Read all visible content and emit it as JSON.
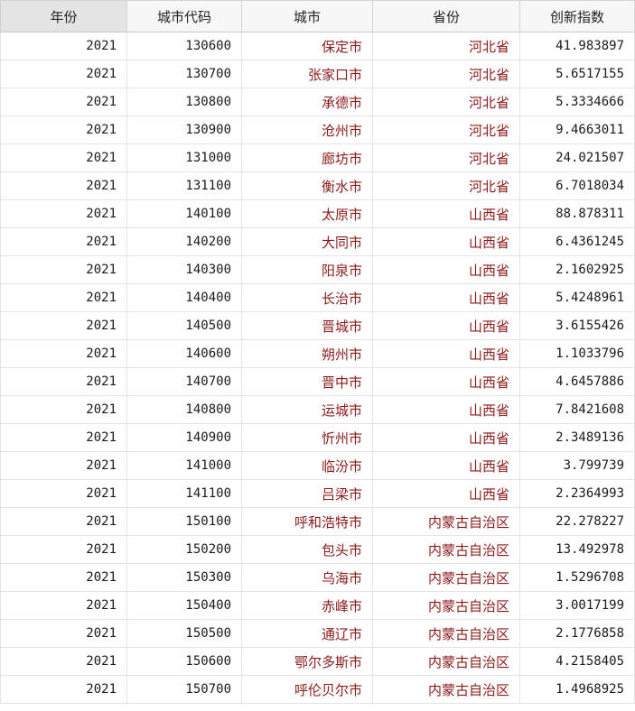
{
  "colors": {
    "string_text": "#8b1a1a",
    "numeric_text": "#1a1a1a",
    "header_bg": "#f7f7f7",
    "selected_header_bg": "#e4e4e4",
    "grid_line": "#e3e3e3"
  },
  "table": {
    "columns": [
      "年份",
      "城市代码",
      "城市",
      "省份",
      "创新指数"
    ],
    "rows": [
      [
        "2021",
        "130600",
        "保定市",
        "河北省",
        "41.983897"
      ],
      [
        "2021",
        "130700",
        "张家口市",
        "河北省",
        "5.6517155"
      ],
      [
        "2021",
        "130800",
        "承德市",
        "河北省",
        "5.3334666"
      ],
      [
        "2021",
        "130900",
        "沧州市",
        "河北省",
        "9.4663011"
      ],
      [
        "2021",
        "131000",
        "廊坊市",
        "河北省",
        "24.021507"
      ],
      [
        "2021",
        "131100",
        "衡水市",
        "河北省",
        "6.7018034"
      ],
      [
        "2021",
        "140100",
        "太原市",
        "山西省",
        "88.878311"
      ],
      [
        "2021",
        "140200",
        "大同市",
        "山西省",
        "6.4361245"
      ],
      [
        "2021",
        "140300",
        "阳泉市",
        "山西省",
        "2.1602925"
      ],
      [
        "2021",
        "140400",
        "长治市",
        "山西省",
        "5.4248961"
      ],
      [
        "2021",
        "140500",
        "晋城市",
        "山西省",
        "3.6155426"
      ],
      [
        "2021",
        "140600",
        "朔州市",
        "山西省",
        "1.1033796"
      ],
      [
        "2021",
        "140700",
        "晋中市",
        "山西省",
        "4.6457886"
      ],
      [
        "2021",
        "140800",
        "运城市",
        "山西省",
        "7.8421608"
      ],
      [
        "2021",
        "140900",
        "忻州市",
        "山西省",
        "2.3489136"
      ],
      [
        "2021",
        "141000",
        "临汾市",
        "山西省",
        "3.799739"
      ],
      [
        "2021",
        "141100",
        "吕梁市",
        "山西省",
        "2.2364993"
      ],
      [
        "2021",
        "150100",
        "呼和浩特市",
        "内蒙古自治区",
        "22.278227"
      ],
      [
        "2021",
        "150200",
        "包头市",
        "内蒙古自治区",
        "13.492978"
      ],
      [
        "2021",
        "150300",
        "乌海市",
        "内蒙古自治区",
        "1.5296708"
      ],
      [
        "2021",
        "150400",
        "赤峰市",
        "内蒙古自治区",
        "3.0017199"
      ],
      [
        "2021",
        "150500",
        "通辽市",
        "内蒙古自治区",
        "2.1776858"
      ],
      [
        "2021",
        "150600",
        "鄂尔多斯市",
        "内蒙古自治区",
        "4.2158405"
      ],
      [
        "2021",
        "150700",
        "呼伦贝尔市",
        "内蒙古自治区",
        "1.4968925"
      ]
    ]
  }
}
